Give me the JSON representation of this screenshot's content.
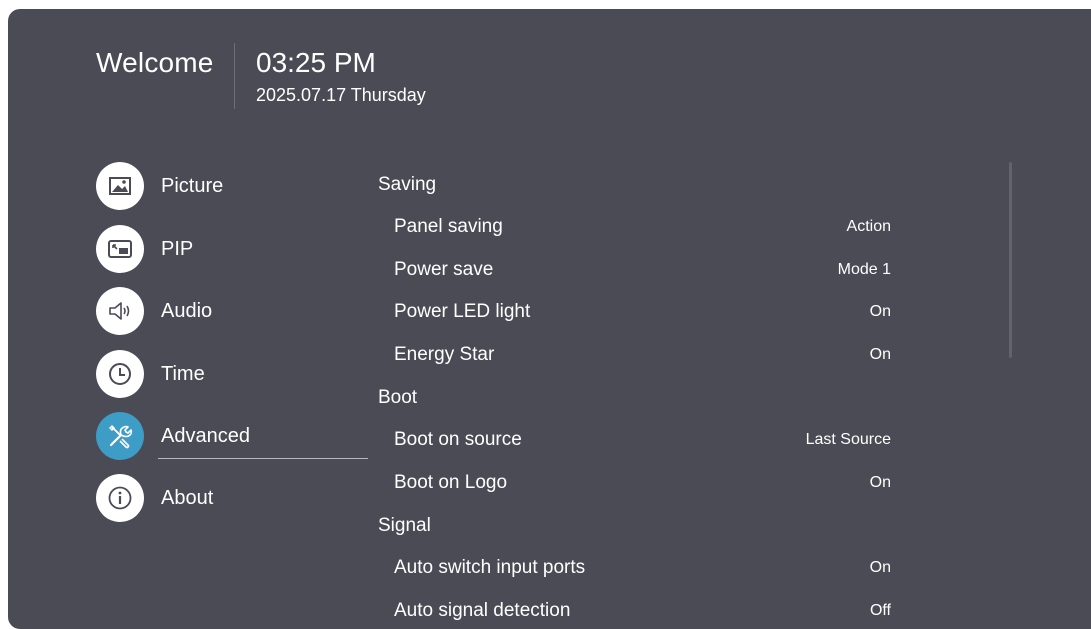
{
  "header": {
    "welcome": "Welcome",
    "time": "03:25 PM",
    "date": "2025.07.17 Thursday"
  },
  "sidebar": {
    "items": [
      {
        "label": "Picture",
        "icon": "picture-icon"
      },
      {
        "label": "PIP",
        "icon": "pip-icon"
      },
      {
        "label": "Audio",
        "icon": "speaker-icon"
      },
      {
        "label": "Time",
        "icon": "clock-icon"
      },
      {
        "label": "Advanced",
        "icon": "tools-icon",
        "active": true
      },
      {
        "label": "About",
        "icon": "info-icon"
      }
    ]
  },
  "settings": {
    "saving": {
      "header": "Saving",
      "rows": [
        {
          "label": "Panel saving",
          "value": "Action"
        },
        {
          "label": "Power save",
          "value": "Mode 1"
        },
        {
          "label": "Power LED light",
          "value": "On"
        },
        {
          "label": "Energy Star",
          "value": "On"
        }
      ]
    },
    "boot": {
      "header": "Boot",
      "rows": [
        {
          "label": "Boot on source",
          "value": "Last Source"
        },
        {
          "label": "Boot on Logo",
          "value": "On"
        }
      ]
    },
    "signal": {
      "header": "Signal",
      "rows": [
        {
          "label": "Auto switch input ports",
          "value": "On"
        },
        {
          "label": "Auto signal detection",
          "value": "Off"
        }
      ]
    }
  },
  "colors": {
    "panel_background": "#4a4b54",
    "accent": "#3d9dc6",
    "text": "#ffffff"
  }
}
